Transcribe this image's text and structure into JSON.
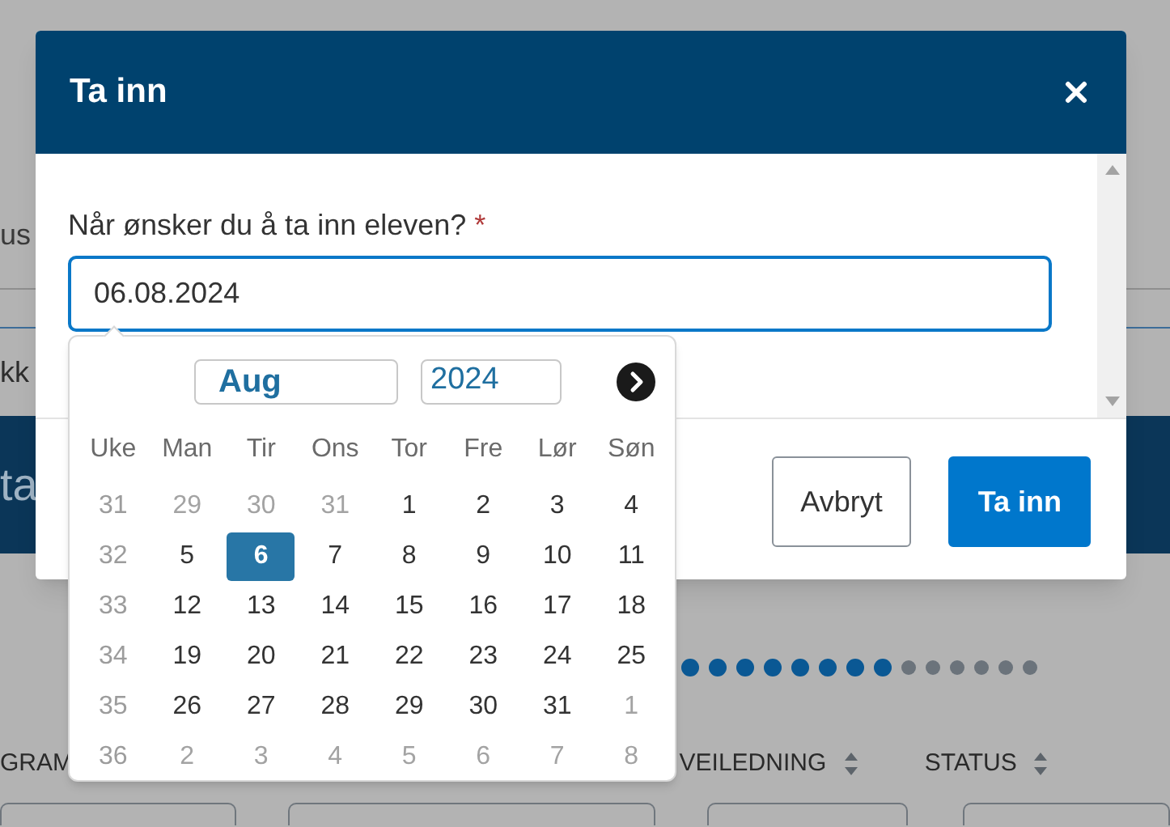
{
  "page": {
    "intro_fragment": "us",
    "tab_fragment": "kk",
    "banner_fragment": "ta",
    "progress": [
      {
        "done": true
      },
      {
        "done": true
      },
      {
        "done": true
      },
      {
        "done": true
      },
      {
        "done": true
      },
      {
        "done": true
      },
      {
        "done": true
      },
      {
        "done": true
      },
      {
        "done": false
      },
      {
        "done": false
      },
      {
        "done": false
      },
      {
        "done": false
      },
      {
        "done": false
      },
      {
        "done": false
      }
    ],
    "table": {
      "columns": [
        {
          "label": "GRAM"
        },
        {
          "label": "VEILEDNING",
          "sortable": true
        },
        {
          "label": "STATUS",
          "sortable": true
        }
      ]
    }
  },
  "dialog": {
    "title": "Ta inn",
    "field": {
      "label": "Når ønsker du å ta inn eleven?",
      "required_mark": "*",
      "value": "06.08.2024"
    },
    "datepicker": {
      "month": "Aug",
      "year": "2024",
      "week_label": "Uke",
      "weekdays": [
        "Man",
        "Tir",
        "Ons",
        "Tor",
        "Fre",
        "Lør",
        "Søn"
      ],
      "weeks": [
        {
          "week": "31",
          "days": [
            {
              "label": "29",
              "outside": true,
              "selected": false
            },
            {
              "label": "30",
              "outside": true,
              "selected": false
            },
            {
              "label": "31",
              "outside": true,
              "selected": false
            },
            {
              "label": "1",
              "outside": false,
              "selected": false
            },
            {
              "label": "2",
              "outside": false,
              "selected": false
            },
            {
              "label": "3",
              "outside": false,
              "selected": false
            },
            {
              "label": "4",
              "outside": false,
              "selected": false
            }
          ]
        },
        {
          "week": "32",
          "days": [
            {
              "label": "5",
              "outside": false,
              "selected": false
            },
            {
              "label": "6",
              "outside": false,
              "selected": true
            },
            {
              "label": "7",
              "outside": false,
              "selected": false
            },
            {
              "label": "8",
              "outside": false,
              "selected": false
            },
            {
              "label": "9",
              "outside": false,
              "selected": false
            },
            {
              "label": "10",
              "outside": false,
              "selected": false
            },
            {
              "label": "11",
              "outside": false,
              "selected": false
            }
          ]
        },
        {
          "week": "33",
          "days": [
            {
              "label": "12",
              "outside": false,
              "selected": false
            },
            {
              "label": "13",
              "outside": false,
              "selected": false
            },
            {
              "label": "14",
              "outside": false,
              "selected": false
            },
            {
              "label": "15",
              "outside": false,
              "selected": false
            },
            {
              "label": "16",
              "outside": false,
              "selected": false
            },
            {
              "label": "17",
              "outside": false,
              "selected": false
            },
            {
              "label": "18",
              "outside": false,
              "selected": false
            }
          ]
        },
        {
          "week": "34",
          "days": [
            {
              "label": "19",
              "outside": false,
              "selected": false
            },
            {
              "label": "20",
              "outside": false,
              "selected": false
            },
            {
              "label": "21",
              "outside": false,
              "selected": false
            },
            {
              "label": "22",
              "outside": false,
              "selected": false
            },
            {
              "label": "23",
              "outside": false,
              "selected": false
            },
            {
              "label": "24",
              "outside": false,
              "selected": false
            },
            {
              "label": "25",
              "outside": false,
              "selected": false
            }
          ]
        },
        {
          "week": "35",
          "days": [
            {
              "label": "26",
              "outside": false,
              "selected": false
            },
            {
              "label": "27",
              "outside": false,
              "selected": false
            },
            {
              "label": "28",
              "outside": false,
              "selected": false
            },
            {
              "label": "29",
              "outside": false,
              "selected": false
            },
            {
              "label": "30",
              "outside": false,
              "selected": false
            },
            {
              "label": "31",
              "outside": false,
              "selected": false
            },
            {
              "label": "1",
              "outside": true,
              "selected": false
            }
          ]
        },
        {
          "week": "36",
          "days": [
            {
              "label": "2",
              "outside": true,
              "selected": false
            },
            {
              "label": "3",
              "outside": true,
              "selected": false
            },
            {
              "label": "4",
              "outside": true,
              "selected": false
            },
            {
              "label": "5",
              "outside": true,
              "selected": false
            },
            {
              "label": "6",
              "outside": true,
              "selected": false
            },
            {
              "label": "7",
              "outside": true,
              "selected": false
            },
            {
              "label": "8",
              "outside": true,
              "selected": false
            }
          ]
        }
      ]
    },
    "buttons": [
      {
        "label": "Avbryt",
        "kind": "secondary"
      },
      {
        "label": "Ta inn",
        "kind": "primary"
      }
    ]
  }
}
